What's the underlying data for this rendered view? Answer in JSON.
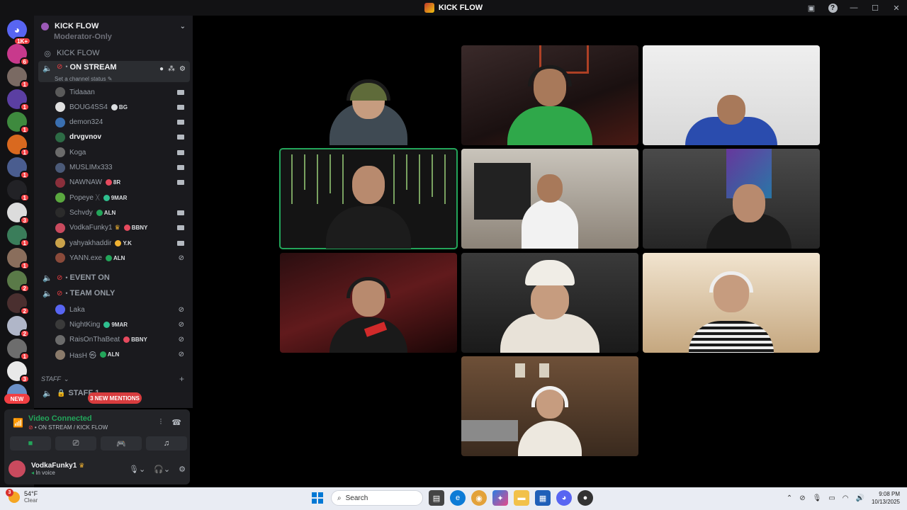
{
  "window": {
    "title": "KICK FLOW"
  },
  "rail": {
    "home_badge": "1K+",
    "servers": [
      {
        "color": "#c8398c",
        "badge": "6"
      },
      {
        "color": "#7a6a63",
        "badge": "1"
      },
      {
        "color": "#5b3fa2",
        "badge": "1"
      },
      {
        "color": "#3e8a3e",
        "badge": "1"
      },
      {
        "color": "#d9691f",
        "badge": "1"
      },
      {
        "color": "#4a5d8f",
        "badge": "1"
      },
      {
        "color": "#222226",
        "badge": "1"
      },
      {
        "color": "#dcdcdc",
        "badge": "3"
      },
      {
        "color": "#3a7d5a",
        "badge": "1"
      },
      {
        "color": "#8a6e5c",
        "badge": "1"
      },
      {
        "color": "#5a7a48",
        "badge": "2"
      },
      {
        "color": "#4a2f2f",
        "badge": "2"
      },
      {
        "color": "#b0b6c8",
        "badge": "2"
      },
      {
        "color": "#6d6d6d",
        "badge": "1"
      },
      {
        "color": "#e9e9e9",
        "badge": "3"
      },
      {
        "color": "#6a8fc6",
        "badge": ""
      }
    ],
    "new_label": "NEW"
  },
  "sidebar": {
    "server_name": "KICK FLOW",
    "cut_text": "Moderator-Only",
    "kickflow_channel": "KICK FLOW",
    "on_stream": {
      "name": "ON STREAM",
      "status_hint": "Set a channel status"
    },
    "stream_users": [
      {
        "name": "Tidaaan",
        "color": "#5a5a5a",
        "tag": "",
        "tag_color": "",
        "crown": false,
        "icon": "video"
      },
      {
        "name": "BOUG4SS4",
        "color": "#e0e0e0",
        "tag": "BG",
        "tag_color": "#dbdee1",
        "crown": false,
        "icon": "video"
      },
      {
        "name": "demon324",
        "color": "#3a6fb0",
        "tag": "",
        "tag_color": "",
        "crown": false,
        "icon": "video"
      },
      {
        "name": "drvgvnov",
        "color": "#2d6b45",
        "tag": "",
        "tag_color": "",
        "crown": false,
        "icon": "video",
        "bright": true
      },
      {
        "name": "Koga",
        "color": "#6b6b6b",
        "tag": "",
        "tag_color": "",
        "crown": false,
        "icon": "video"
      },
      {
        "name": "MUSLIMx333",
        "color": "#4b5a78",
        "tag": "",
        "tag_color": "",
        "crown": false,
        "icon": "video"
      },
      {
        "name": "NAWNAW",
        "color": "#8a2f3b",
        "tag": "8R",
        "tag_color": "#e64a5e",
        "crown": false,
        "icon": "video"
      },
      {
        "name": "Popeye ᚷ",
        "color": "#5aa83f",
        "tag": "9MAR",
        "tag_color": "#2fbf8f",
        "crown": false,
        "icon": "none"
      },
      {
        "name": "Schvdy",
        "color": "#2b2b2b",
        "tag": "ALN",
        "tag_color": "#23a55a",
        "crown": false,
        "icon": "video"
      },
      {
        "name": "VodkaFunky1",
        "color": "#c94a5e",
        "tag": "BBNY",
        "tag_color": "#e64a5e",
        "crown": true,
        "icon": "video"
      },
      {
        "name": "yahyakhaddir",
        "color": "#c9a24a",
        "tag": "Y.K",
        "tag_color": "#f0b232",
        "crown": false,
        "icon": "video"
      },
      {
        "name": "YANN.exe",
        "color": "#8a4a3a",
        "tag": "ALN",
        "tag_color": "#23a55a",
        "crown": false,
        "icon": "muted"
      }
    ],
    "event_on": "EVENT ON",
    "team_only": "TEAM ONLY",
    "team_users": [
      {
        "name": "Laka",
        "color": "#5865f2",
        "tag": "",
        "tag_color": ""
      },
      {
        "name": "NightKing",
        "color": "#3a3a3a",
        "tag": "9MAR",
        "tag_color": "#2fbf8f"
      },
      {
        "name": "RaisOnThaBeat",
        "color": "#6b6b6b",
        "tag": "BBNY",
        "tag_color": "#e64a5e"
      },
      {
        "name": "HasH ㉿",
        "color": "#8a7a6a",
        "tag": "ALN",
        "tag_color": "#23a55a"
      }
    ],
    "staff_category": "STAFF",
    "staff_channel": "STAFF 1",
    "mentions_pill": "3 NEW MENTIONS"
  },
  "voice": {
    "status": "Video Connected",
    "location": "ON STREAM / KICK FLOW"
  },
  "user_panel": {
    "name": "VodkaFunky1",
    "status": "In voice"
  },
  "taskbar": {
    "temperature": "54°F",
    "condition": "Clear",
    "weather_badge": "3",
    "search_placeholder": "Search",
    "time": "9:08 PM",
    "date": "10/13/2025"
  }
}
